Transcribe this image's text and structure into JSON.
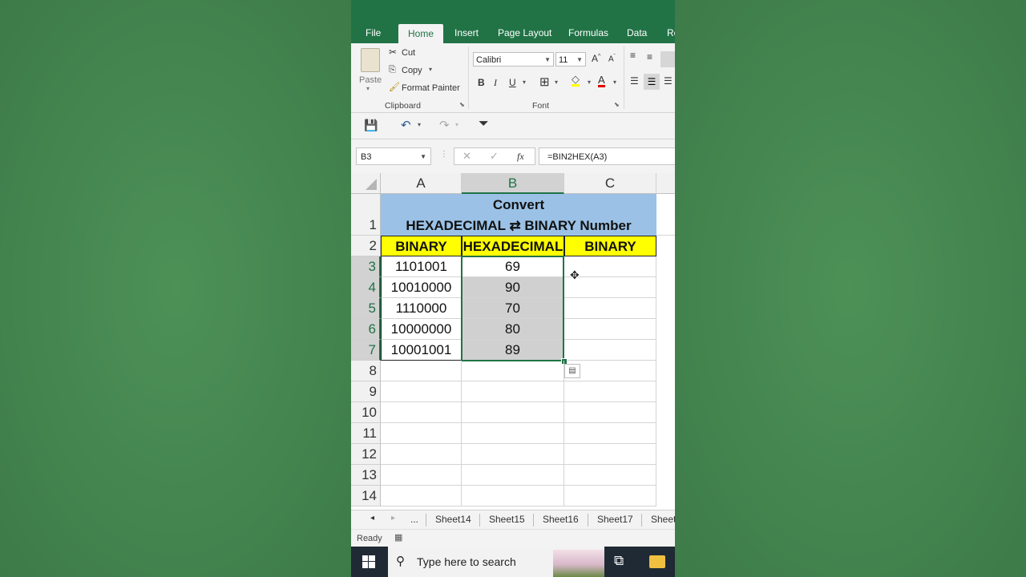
{
  "ribbon_tabs": [
    "File",
    "Home",
    "Insert",
    "Page Layout",
    "Formulas",
    "Data",
    "Re"
  ],
  "clipboard": {
    "paste": "Paste",
    "cut": "Cut",
    "copy": "Copy",
    "format_painter": "Format Painter",
    "group": "Clipboard"
  },
  "font": {
    "name": "Calibri",
    "size": "11",
    "group": "Font"
  },
  "name_box": "B3",
  "formula": "=BIN2HEX(A3)",
  "fx": "fx",
  "columns": [
    "A",
    "B",
    "C"
  ],
  "rows": [
    "1",
    "2",
    "3",
    "4",
    "5",
    "6",
    "7",
    "8",
    "9",
    "10",
    "11",
    "12",
    "13",
    "14"
  ],
  "title_line1": "Convert",
  "title_line2": "HEXADECIMAL ⇄ BINARY Number",
  "headers": [
    "BINARY",
    "HEXADECIMAL",
    "BINARY"
  ],
  "data_rows": [
    {
      "binary": "1101001",
      "hex": "69"
    },
    {
      "binary": "10010000",
      "hex": "90"
    },
    {
      "binary": "1110000",
      "hex": "70"
    },
    {
      "binary": "10000000",
      "hex": "80"
    },
    {
      "binary": "10001001",
      "hex": "89"
    }
  ],
  "sheet_nav": {
    "prev": "◂",
    "next": "▸",
    "more": "..."
  },
  "sheets": [
    "Sheet14",
    "Sheet15",
    "Sheet16",
    "Sheet17",
    "Sheet"
  ],
  "status": "Ready",
  "taskbar": {
    "search_placeholder": "Type here to search"
  },
  "colors": {
    "excel_green": "#217346",
    "title_fill": "#9bc2e6",
    "header_fill": "#ffff00",
    "selection_fill": "#d0d0d0"
  }
}
